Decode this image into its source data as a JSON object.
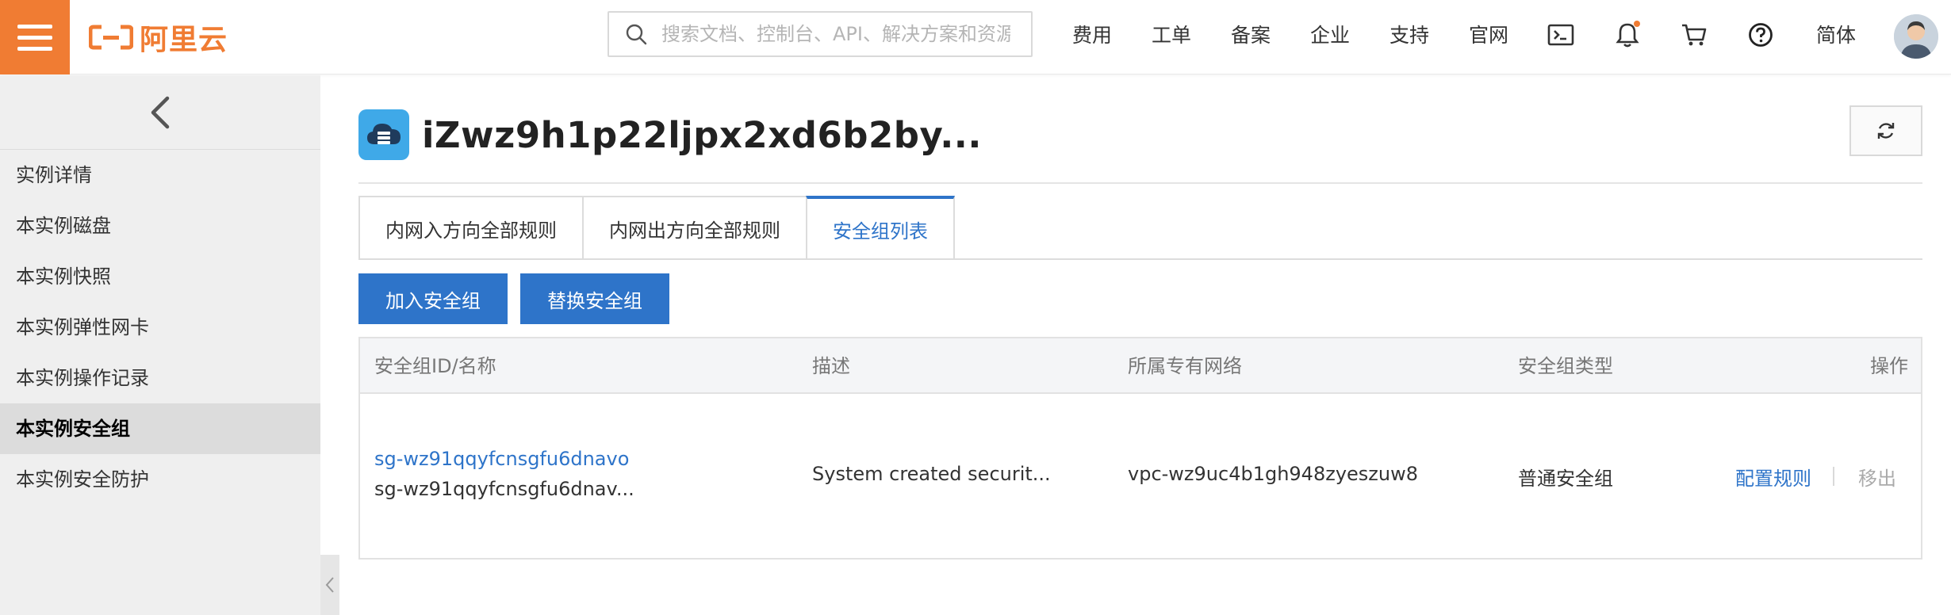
{
  "brand": {
    "logo_text": "阿里云",
    "accent": "#f07c33",
    "primary": "#2e74c9"
  },
  "search": {
    "placeholder": "搜索文档、控制台、API、解决方案和资源"
  },
  "topnav": {
    "links": [
      "费用",
      "工单",
      "备案",
      "企业",
      "支持",
      "官网"
    ],
    "language": "简体",
    "icons": [
      "terminal-icon",
      "bell-icon",
      "cart-icon",
      "help-icon"
    ]
  },
  "sidebar": {
    "items": [
      {
        "label": "实例详情"
      },
      {
        "label": "本实例磁盘"
      },
      {
        "label": "本实例快照"
      },
      {
        "label": "本实例弹性网卡"
      },
      {
        "label": "本实例操作记录"
      },
      {
        "label": "本实例安全组",
        "active": true
      },
      {
        "label": "本实例安全防护"
      }
    ]
  },
  "page": {
    "title": "iZwz9h1p22ljpx2xd6b2by..."
  },
  "tabs": [
    {
      "label": "内网入方向全部规则"
    },
    {
      "label": "内网出方向全部规则"
    },
    {
      "label": "安全组列表",
      "active": true
    }
  ],
  "actions": {
    "add": "加入安全组",
    "replace": "替换安全组"
  },
  "table": {
    "headers": [
      "安全组ID/名称",
      "描述",
      "所属专有网络",
      "安全组类型",
      "操作"
    ],
    "rows": [
      {
        "id": "sg-wz91qqyfcnsgfu6dnavo",
        "name": "sg-wz91qqyfcnsgfu6dnav...",
        "description": "System created securit...",
        "vpc": "vpc-wz9uc4b1gh948zyeszuw8",
        "type": "普通安全组",
        "op_config": "配置规则",
        "op_remove": "移出"
      }
    ]
  }
}
